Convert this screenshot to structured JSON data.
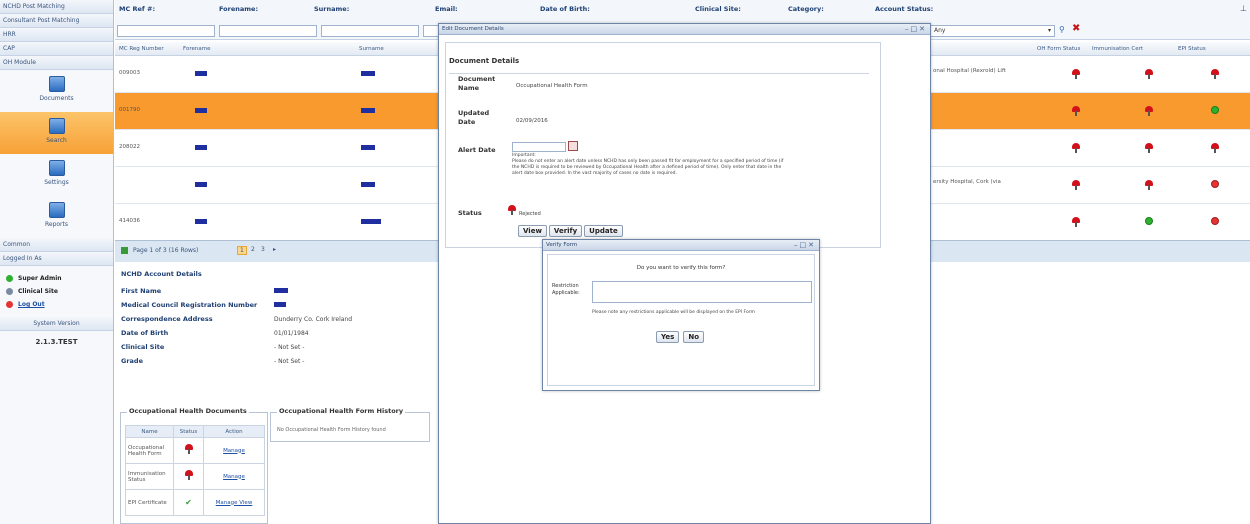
{
  "sidebar": {
    "top_items": [
      "NCHD Post Matching",
      "Consultant Post Matching",
      "HRR",
      "CAP",
      "OH Module"
    ],
    "tiles": [
      {
        "label": "Documents",
        "active": false
      },
      {
        "label": "Search",
        "active": true
      },
      {
        "label": "Settings",
        "active": false
      },
      {
        "label": "Reports",
        "active": false
      }
    ],
    "common": "Common",
    "logged_in": "Logged In As",
    "user_items": [
      {
        "label": "Super Admin",
        "color": "#2eb12e"
      },
      {
        "label": "Clinical Site",
        "color": "#7a8aa0"
      },
      {
        "label": "Log Out",
        "color": "#e43434"
      }
    ],
    "system_version_label": "System Version",
    "version": "2.1.3.TEST"
  },
  "filters": {
    "labels": [
      "MC Ref #:",
      "Forename:",
      "Surname:",
      "Email:",
      "Date of Birth:",
      "Clinical Site:",
      "Category:",
      "Account Status:"
    ],
    "account_status_value": "Any"
  },
  "grid": {
    "headers": [
      "MC Reg Number",
      "Forename",
      "Surname",
      "OH Form Status",
      "Immunisation Cert",
      "EPI Status"
    ],
    "rows": [
      {
        "reg": "009003",
        "extra": "onal Hospital (Rexrold) Lift",
        "oh": "pin",
        "imm": "pin",
        "epi": "pin",
        "sel": false
      },
      {
        "reg": "001790",
        "extra": "",
        "oh": "pin",
        "imm": "pin",
        "epi": "ok",
        "sel": true
      },
      {
        "reg": "208022",
        "extra": "",
        "oh": "pin",
        "imm": "pin",
        "epi": "pin",
        "sel": false
      },
      {
        "reg": "",
        "extra": "ersity Hospital, Cork (via",
        "oh": "pin",
        "imm": "pin",
        "epi": "no",
        "sel": false
      },
      {
        "reg": "414036",
        "extra": "",
        "oh": "pin",
        "imm": "ok",
        "epi": "no",
        "sel": false
      }
    ],
    "pager": "Page 1 of 3 (16 Rows)"
  },
  "account": {
    "title": "NCHD Account Details",
    "fields": [
      {
        "label": "First Name",
        "value": ""
      },
      {
        "label": "Medical Council Registration Number",
        "value": ""
      },
      {
        "label": "Correspondence Address",
        "value": "Dunderry Co. Cork Ireland"
      },
      {
        "label": "Date of Birth",
        "value": "01/01/1984"
      },
      {
        "label": "Clinical Site",
        "value": "- Not Set -"
      },
      {
        "label": "Grade",
        "value": "- Not Set -"
      }
    ]
  },
  "oh_docs": {
    "title": "Occupational Health Documents",
    "headers": [
      "Name",
      "Status",
      "Action"
    ],
    "rows": [
      {
        "name": "Occupational Health Form",
        "status": "pin",
        "action": "Manage"
      },
      {
        "name": "Immunisation Status",
        "status": "pin",
        "action": "Manage"
      },
      {
        "name": "EPI Certificate",
        "status": "check",
        "action": "Manage View"
      }
    ]
  },
  "oh_history": {
    "title": "Occupational Health Form History",
    "empty": "No Occupational Health Form History found"
  },
  "edit_dialog": {
    "title": "Edit Document Details",
    "section": "Document Details",
    "doc_name_label": "Document Name",
    "doc_name": "Occupational Health Form",
    "updated_label": "Updated Date",
    "updated": "02/09/2016",
    "alert_label": "Alert Date",
    "alert_hint_title": "Important:",
    "alert_hint": "Please do not enter an alert date unless NCHD has only been passed fit for employment for a specified period of time (if the NCHD is required to be reviewed by Occupational Health after a defined period of time). Only enter that date in the alert date box provided. In the vast majority of cases no date is required.",
    "status_label": "Status",
    "status_value": "Rejected",
    "buttons": [
      "View",
      "Verify",
      "Update"
    ]
  },
  "verify_dialog": {
    "title": "Verify Form",
    "question": "Do you want to verify this form?",
    "restriction_label": "Restriction Applicable:",
    "note": "Please note any restrictions applicable will be displayed on the EPI Form",
    "yes": "Yes",
    "no": "No"
  }
}
